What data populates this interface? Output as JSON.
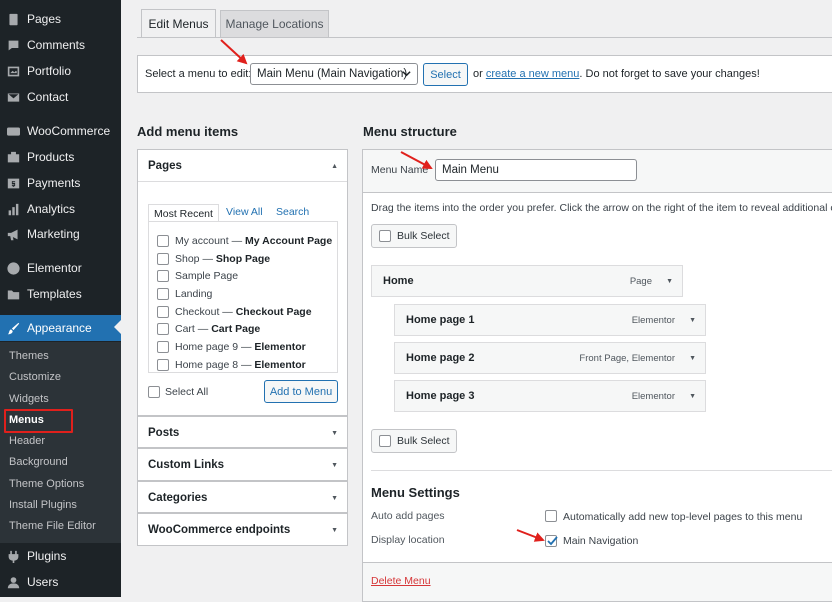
{
  "sidebar": {
    "items": [
      {
        "label": "Pages",
        "icon": "pages-icon"
      },
      {
        "label": "Comments",
        "icon": "comments-icon"
      },
      {
        "label": "Portfolio",
        "icon": "portfolio-icon"
      },
      {
        "label": "Contact",
        "icon": "contact-icon"
      },
      {
        "label": "WooCommerce",
        "icon": "woocommerce-icon"
      },
      {
        "label": "Products",
        "icon": "products-icon"
      },
      {
        "label": "Payments",
        "icon": "payments-icon"
      },
      {
        "label": "Analytics",
        "icon": "analytics-icon"
      },
      {
        "label": "Marketing",
        "icon": "marketing-icon"
      },
      {
        "label": "Elementor",
        "icon": "elementor-icon"
      },
      {
        "label": "Templates",
        "icon": "templates-icon"
      },
      {
        "label": "Appearance",
        "icon": "appearance-icon"
      },
      {
        "label": "Plugins",
        "icon": "plugins-icon"
      },
      {
        "label": "Users",
        "icon": "users-icon"
      }
    ],
    "submenu": [
      "Themes",
      "Customize",
      "Widgets",
      "Menus",
      "Header",
      "Background",
      "Theme Options",
      "Install Plugins",
      "Theme File Editor"
    ]
  },
  "tabs": [
    "Edit Menus",
    "Manage Locations"
  ],
  "select_bar": {
    "prompt": "Select a menu to edit:",
    "selected_menu": "Main Menu (Main Navigation)",
    "select_button": "Select",
    "or_text": "or",
    "create_link": "create a new menu",
    "suffix": ". Do not forget to save your changes!"
  },
  "add_items": {
    "heading": "Add menu items",
    "pages": {
      "title": "Pages",
      "tabs": [
        "Most Recent",
        "View All",
        "Search"
      ],
      "list": [
        {
          "name": "My account",
          "tag": "My Account Page"
        },
        {
          "name": "Shop",
          "tag": "Shop Page"
        },
        {
          "name": "Sample Page",
          "tag": ""
        },
        {
          "name": "Landing",
          "tag": ""
        },
        {
          "name": "Checkout",
          "tag": "Checkout Page"
        },
        {
          "name": "Cart",
          "tag": "Cart Page"
        },
        {
          "name": "Home page 9",
          "tag": "Elementor"
        },
        {
          "name": "Home page 8",
          "tag": "Elementor"
        }
      ],
      "select_all": "Select All",
      "add_button": "Add to Menu"
    },
    "sections": [
      "Posts",
      "Custom Links",
      "Categories",
      "WooCommerce endpoints"
    ]
  },
  "structure": {
    "heading": "Menu structure",
    "name_label": "Menu Name",
    "name_value": "Main Menu",
    "instructions": "Drag the items into the order you prefer. Click the arrow on the right of the item to reveal additional co",
    "bulk_select": "Bulk Select",
    "items": [
      {
        "title": "Home",
        "type": "Page"
      },
      {
        "title": "Home page 1",
        "type": "Elementor"
      },
      {
        "title": "Home page 2",
        "type": "Front Page, Elementor"
      },
      {
        "title": "Home page 3",
        "type": "Elementor"
      }
    ],
    "settings": {
      "heading": "Menu Settings",
      "auto_add_label": "Auto add pages",
      "auto_add_text": "Automatically add new top-level pages to this menu",
      "auto_add_checked": false,
      "display_label": "Display location",
      "display_text": "Main Navigation",
      "display_checked": true
    },
    "delete_link": "Delete Menu"
  },
  "colors": {
    "sidebar_bg": "#1d2327",
    "accent": "#2271b1",
    "annotation_red": "#e0201c"
  }
}
